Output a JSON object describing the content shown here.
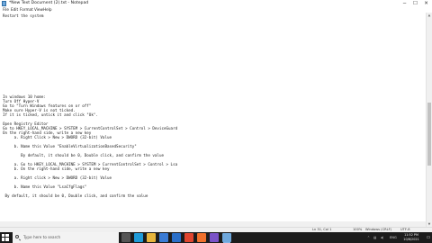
{
  "window": {
    "title": "*New Text Document (2).txt - Notepad",
    "minimize": "─",
    "maximize": "☐",
    "close": "✕"
  },
  "menu": [
    "File",
    "Edit",
    "Format",
    "View",
    "Help"
  ],
  "document": {
    "lines": [
      "Restart the system",
      "",
      "",
      "",
      "",
      "",
      "",
      "",
      "",
      "",
      "",
      "",
      "",
      "",
      "",
      "",
      "",
      "",
      "In windows 10 home:",
      "Turn Off Hyper-V",
      "Go to \"Turn Windows features on or off\"",
      "Make sure Hyper-V is not ticked.",
      "If it is ticked, untick it and click \"Ok\".",
      "",
      "Open Registry Editor",
      "Go to HKEY_LOCAL_MACHINE > SYSTEM > CurrentControlSet > Control > DeviceGuard",
      "On the right-hand side, write a new key",
      "     a. Right Click > New > DWORD (32-bit) Value",
      "",
      "     b. Name this Value \"EnableVirtualizationBasedSecurity\"",
      "",
      "        By default, it should be 0, Double click, and confirm the value",
      "",
      "     a. Go to HKEY_LOCAL_MACHINE > SYSTEM > CurrentControlSet > Control > Lsa",
      "     b. On the right-hand side, write a new key",
      "",
      "     a. Right click > New > DWORD (32-bit) Value",
      "",
      "     b. Name this Value \"LsaCfgFlags\"",
      "",
      " By default, it should be 0, Double click, and confirm the value"
    ]
  },
  "statusbar": {
    "position": "Ln 31, Col 1",
    "zoom": "100%",
    "line_ending": "Windows (CRLF)",
    "encoding": "UTF-8"
  },
  "taskbar": {
    "search_placeholder": "Type here to search",
    "time": "11:52 PM",
    "date": "10/6/2021",
    "icons": [
      {
        "name": "task-view-icon",
        "color": "#555555"
      },
      {
        "name": "edge-icon",
        "color": "#1f9bd8"
      },
      {
        "name": "file-explorer-icon",
        "color": "#e7b53c"
      },
      {
        "name": "store-icon",
        "color": "#3a7bd5"
      },
      {
        "name": "mail-icon",
        "color": "#2a6fc9"
      },
      {
        "name": "chrome-icon",
        "color": "#e0452f"
      },
      {
        "name": "firefox-icon",
        "color": "#f0702c"
      },
      {
        "name": "app-icon",
        "color": "#7a52c7"
      },
      {
        "name": "notepad-icon",
        "color": "#6fa8dc"
      }
    ]
  }
}
